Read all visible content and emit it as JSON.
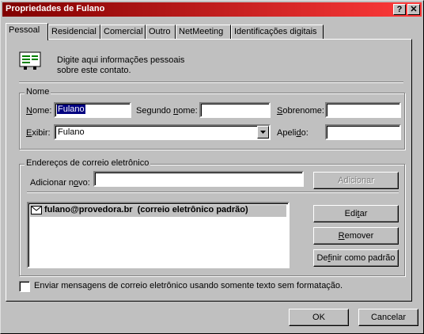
{
  "window": {
    "title": "Propriedades de Fulano"
  },
  "titlebar_buttons": {
    "help": "?",
    "close": "✕"
  },
  "tabs": [
    {
      "label": "Pessoal"
    },
    {
      "label": "Residencial"
    },
    {
      "label": "Comercial"
    },
    {
      "label": "Outro"
    },
    {
      "label": "NetMeeting"
    },
    {
      "label": "Identificações digitais"
    }
  ],
  "intro": {
    "text_line1": "Digite aqui informações pessoais",
    "text_line2": "sobre este contato."
  },
  "nome_group": {
    "legend": "Nome",
    "nome_label": "Nome:",
    "nome_value": "Fulano",
    "segundo_nome_label": "Segundo nome:",
    "segundo_nome_value": "",
    "sobrenome_label": "Sobrenome:",
    "sobrenome_value": "",
    "exibir_label": "Exibir:",
    "exibir_value": "Fulano",
    "apelido_label": "Apelido:",
    "apelido_value": ""
  },
  "email_group": {
    "legend": "Endereços de correio eletrônico",
    "adicionar_label": "Adicionar novo:",
    "adicionar_value": "",
    "adicionar_button": "Adicionar",
    "email_list": [
      {
        "text": "fulano@provedora.br  (correio eletrônico padrão)"
      }
    ],
    "editar_button": "Editar",
    "remover_button": "Remover",
    "definir_button": "Definir como padrão"
  },
  "plain_text_checkbox": {
    "label": "Enviar mensagens de correio eletrônico usando somente texto sem formatação.",
    "checked": false
  },
  "footer": {
    "ok": "OK",
    "cancelar": "Cancelar"
  },
  "colors": {
    "titlebar_start": "#800000",
    "titlebar_end": "#ff3a3a",
    "selection": "#000080"
  }
}
